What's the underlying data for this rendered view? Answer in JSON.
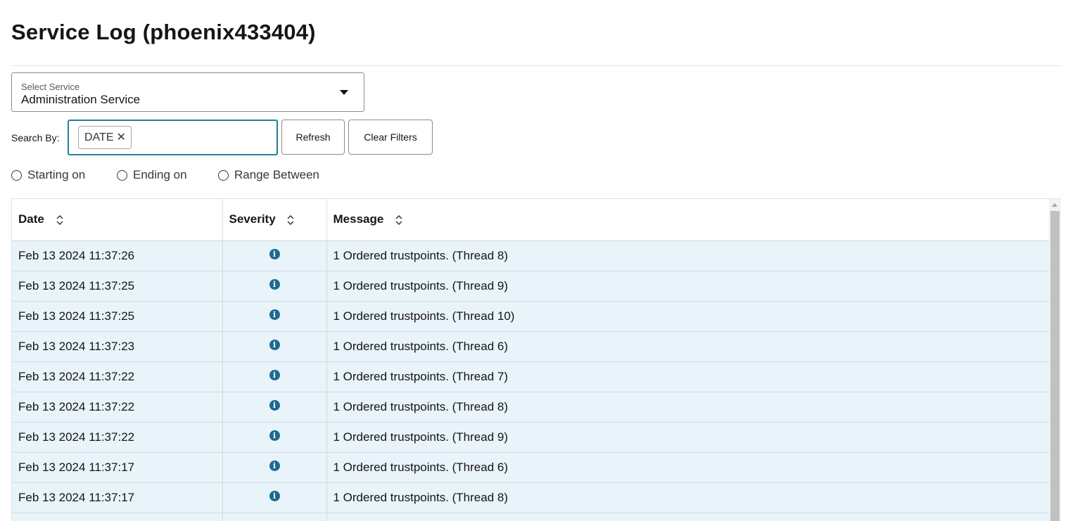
{
  "page": {
    "title": "Service Log (phoenix433404)"
  },
  "service_select": {
    "label": "Select Service",
    "value": "Administration Service"
  },
  "search": {
    "label": "Search By:",
    "chip_label": "DATE",
    "chip_remove": "✕",
    "input_value": ""
  },
  "buttons": {
    "refresh": "Refresh",
    "clear_filters": "Clear Filters"
  },
  "date_options": [
    "Starting on",
    "Ending on",
    "Range Between"
  ],
  "table": {
    "columns": [
      "Date",
      "Severity",
      "Message"
    ],
    "rows": [
      {
        "date": "Feb 13 2024 11:37:26",
        "severity": "info",
        "message": "1 Ordered trustpoints. (Thread 8)"
      },
      {
        "date": "Feb 13 2024 11:37:25",
        "severity": "info",
        "message": "1 Ordered trustpoints. (Thread 9)"
      },
      {
        "date": "Feb 13 2024 11:37:25",
        "severity": "info",
        "message": "1 Ordered trustpoints. (Thread 10)"
      },
      {
        "date": "Feb 13 2024 11:37:23",
        "severity": "info",
        "message": "1 Ordered trustpoints. (Thread 6)"
      },
      {
        "date": "Feb 13 2024 11:37:22",
        "severity": "info",
        "message": "1 Ordered trustpoints. (Thread 7)"
      },
      {
        "date": "Feb 13 2024 11:37:22",
        "severity": "info",
        "message": "1 Ordered trustpoints. (Thread 8)"
      },
      {
        "date": "Feb 13 2024 11:37:22",
        "severity": "info",
        "message": "1 Ordered trustpoints. (Thread 9)"
      },
      {
        "date": "Feb 13 2024 11:37:17",
        "severity": "info",
        "message": "1 Ordered trustpoints. (Thread 6)"
      },
      {
        "date": "Feb 13 2024 11:37:17",
        "severity": "info",
        "message": "1 Ordered trustpoints. (Thread 8)"
      },
      {
        "date": "",
        "severity": "",
        "message": ""
      }
    ]
  },
  "icons": {
    "severity_info": "info-circle-icon",
    "sort": "sort-icon",
    "dropdown": "chevron-down-icon"
  },
  "colors": {
    "accent": "#227e9e",
    "row_background": "#e8f3fa",
    "info_icon": "#1c6b8f"
  }
}
